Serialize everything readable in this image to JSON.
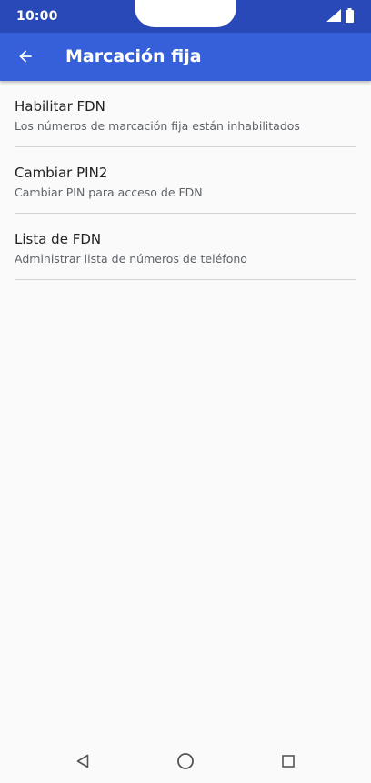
{
  "status_bar": {
    "time": "10:00"
  },
  "app_bar": {
    "title": "Marcación fija",
    "back_icon": "arrow-back-icon"
  },
  "settings": {
    "items": [
      {
        "title": "Habilitar FDN",
        "subtitle": "Los números de marcación fija están inhabilitados"
      },
      {
        "title": "Cambiar PIN2",
        "subtitle": "Cambiar PIN para acceso de FDN"
      },
      {
        "title": "Lista de FDN",
        "subtitle": "Administrar lista de números de teléfono"
      }
    ]
  },
  "nav_bar": {
    "icons": [
      "back-triangle-icon",
      "home-circle-icon",
      "recents-square-icon"
    ]
  },
  "colors": {
    "status_bar": "#2a49b8",
    "app_bar": "#3660d9",
    "background": "#fafafa",
    "title_text": "#212121",
    "subtitle_text": "#5f6368",
    "divider": "#d4d4d4"
  }
}
